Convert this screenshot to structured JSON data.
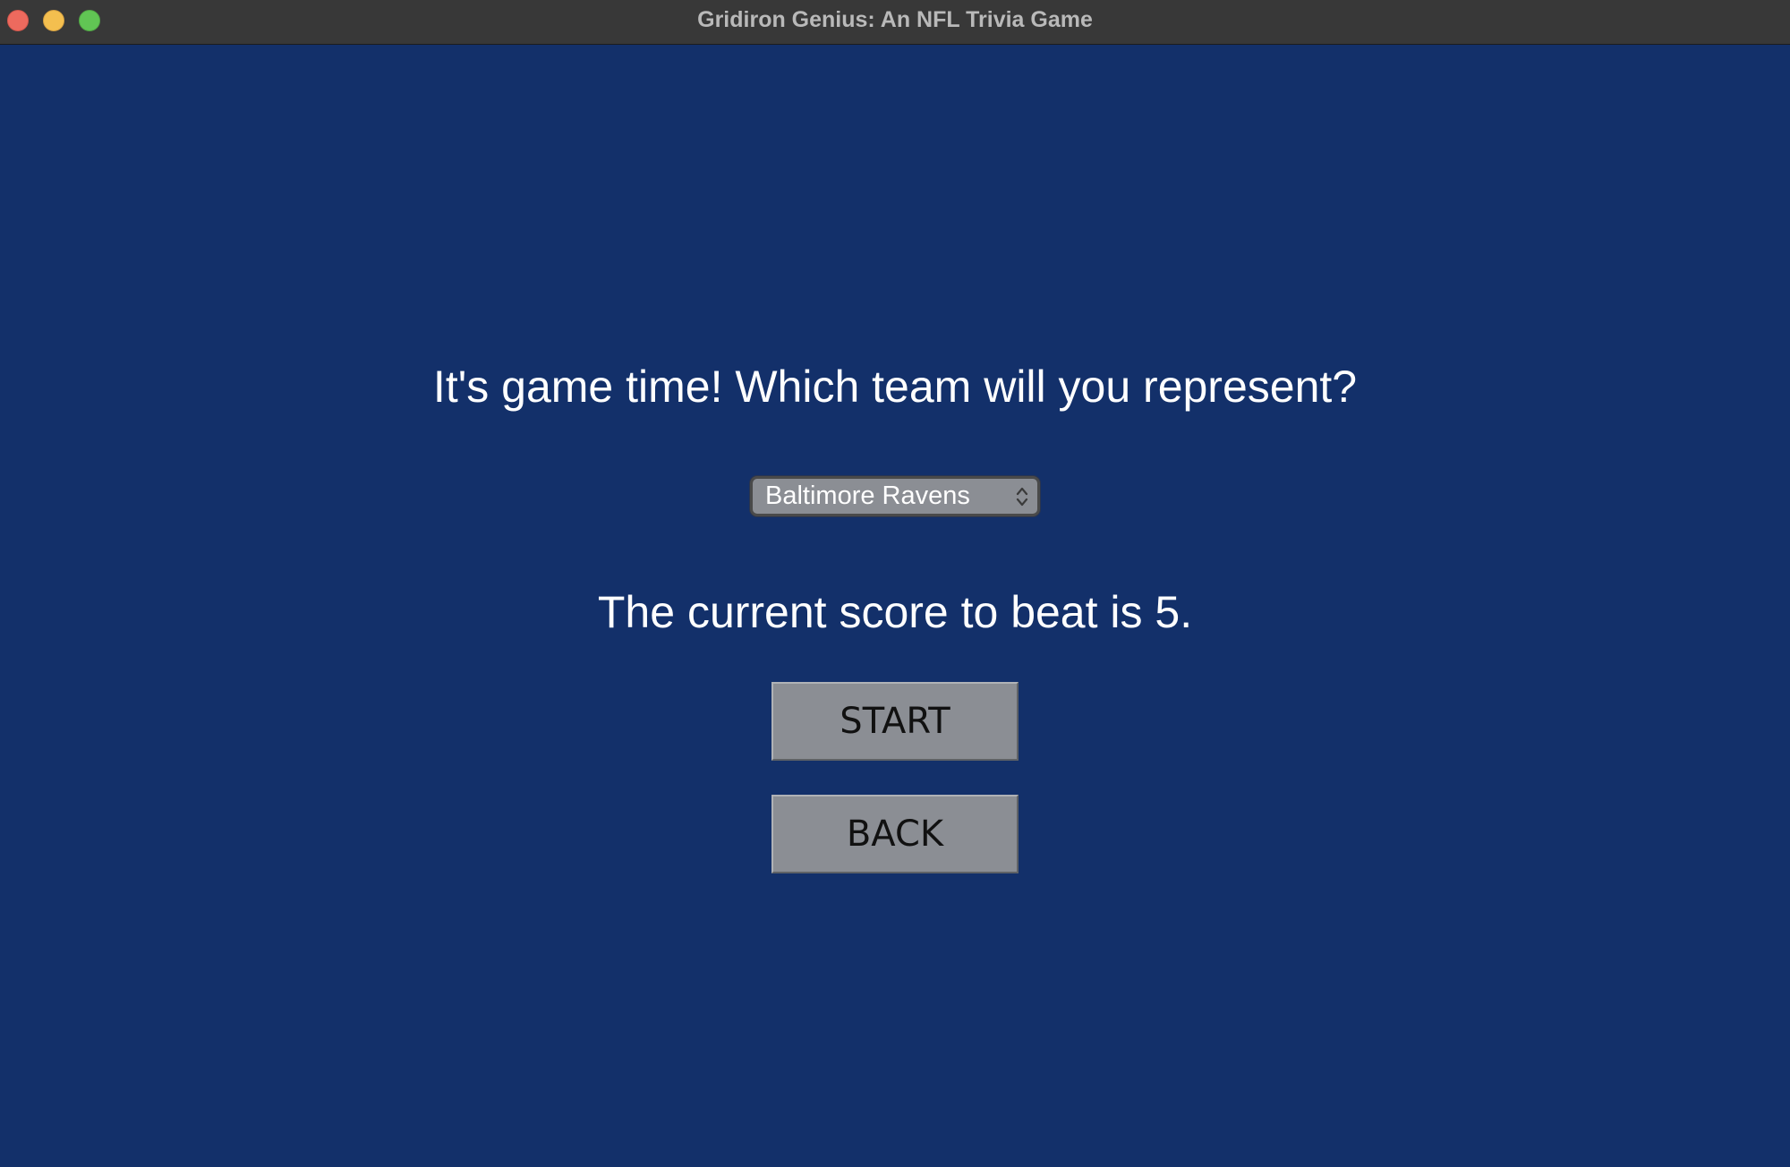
{
  "window": {
    "title": "Gridiron Genius: An NFL Trivia Game"
  },
  "screen": {
    "prompt": "It's game time! Which team will you represent?",
    "team_select": {
      "selected": "Baltimore Ravens",
      "icon": "up-down-chevron-icon"
    },
    "score_text": "The current score to beat is 5.",
    "start_label": "START",
    "back_label": "BACK"
  },
  "colors": {
    "background": "#13306a",
    "titlebar": "#383838",
    "button": "#8b8e94",
    "text": "#ffffff"
  }
}
